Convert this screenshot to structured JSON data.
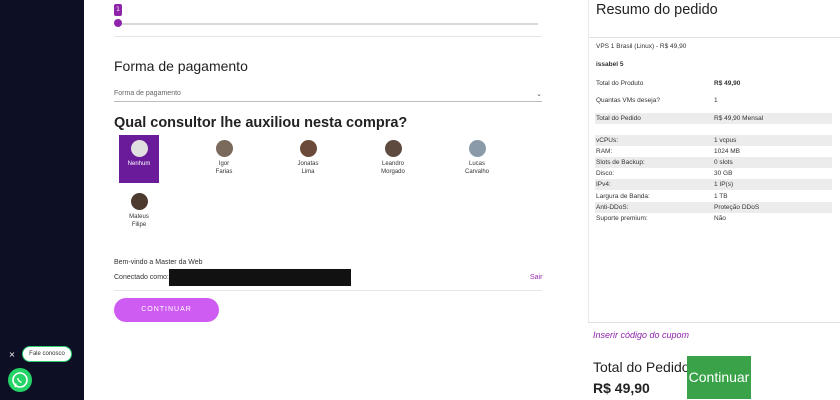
{
  "slider": {
    "badge": "1"
  },
  "payment": {
    "title": "Forma de pagamento",
    "select_placeholder": "Forma de pagamento"
  },
  "consultant_section": {
    "title": "Qual consultor lhe auxiliou nesta compra?",
    "items": [
      {
        "line1": "Nenhum",
        "line2": "",
        "selected": true
      },
      {
        "line1": "Igor",
        "line2": "Farias",
        "selected": false
      },
      {
        "line1": "Jonatas",
        "line2": "Lima",
        "selected": false
      },
      {
        "line1": "Leandro",
        "line2": "Morgado",
        "selected": false
      },
      {
        "line1": "Lucas",
        "line2": "Carvalho",
        "selected": false
      },
      {
        "line1": "Mateus",
        "line2": "Filipe",
        "selected": false
      }
    ]
  },
  "account": {
    "welcome": "Bem-vindo a Master da Web",
    "connected_label": "Conectado como:",
    "logout": "Sair"
  },
  "continue_button": "CONTINUAR",
  "summary": {
    "title": "Resumo do pedido",
    "product_line": "VPS 1 Brasil (Linux) - R$ 49,90",
    "hostname": "issabel 5",
    "rows": [
      {
        "k": "Total do Produto",
        "v": "R$ 49,90",
        "shade": false,
        "bold": true
      },
      {
        "k": "Quantas VMs deseja?",
        "v": "1",
        "shade": false,
        "bold": false
      },
      {
        "k": "Total do Pedido",
        "v": "R$ 49,90 Mensal",
        "shade": true,
        "bold": false
      }
    ],
    "specs": [
      {
        "k": "vCPUs:",
        "v": "1 vcpus",
        "shade": true
      },
      {
        "k": "RAM:",
        "v": "1024 MB",
        "shade": false
      },
      {
        "k": "Slots de Backup:",
        "v": "0 slots",
        "shade": true
      },
      {
        "k": "Disco:",
        "v": "30 GB",
        "shade": false
      },
      {
        "k": "IPv4:",
        "v": "1 IP(s)",
        "shade": true
      },
      {
        "k": "Largura de Banda:",
        "v": "1 TB",
        "shade": false
      },
      {
        "k": "Anti-DDoS:",
        "v": "Proteção DDoS",
        "shade": true
      },
      {
        "k": "Suporte premium:",
        "v": "Não",
        "shade": false
      }
    ]
  },
  "checkout": {
    "coupon_placeholder": "Inserir código do cupom",
    "total_label": "Total do Pedido",
    "total_value": "R$ 49,90",
    "continue_label": "Continuar"
  },
  "chat": {
    "close": "×",
    "label": "Fale conosco"
  },
  "colors": {
    "accent_purple": "#8e24aa",
    "selected_purple": "#6a1b9a",
    "button_pink": "#cf5cf2",
    "green": "#3aa34a",
    "whatsapp": "#25d366",
    "sidebar": "#0d1024"
  }
}
